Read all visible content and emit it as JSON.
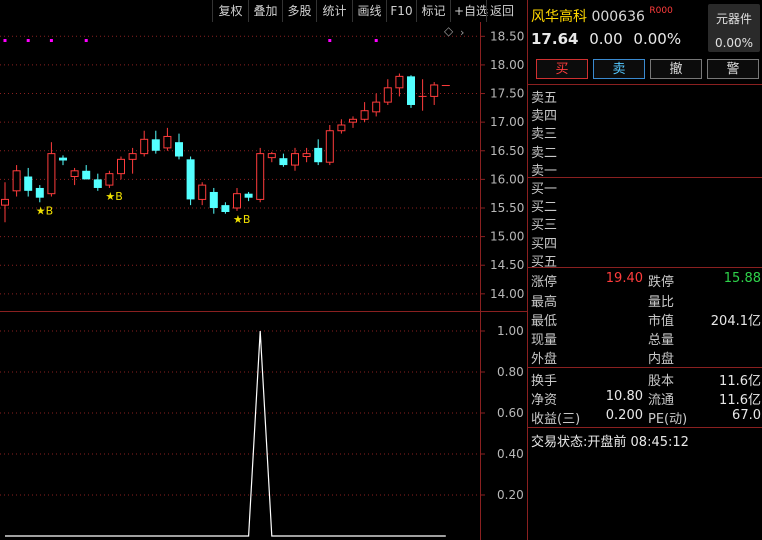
{
  "toolbar": {
    "items": [
      "复权",
      "叠加",
      "多股",
      "统计",
      "画线",
      "F10",
      "标记",
      "+自选",
      "返回"
    ]
  },
  "chart": {
    "price_ticks": [
      "18.50",
      "18.00",
      "17.50",
      "17.00",
      "16.50",
      "16.00",
      "15.50",
      "15.00",
      "14.50",
      "14.00"
    ],
    "indicator_ticks": [
      "1.00",
      "0.80",
      "0.60",
      "0.40",
      "0.20"
    ],
    "signal_label": "★B",
    "colors": {
      "up": "#ff3c3c",
      "down": "#54ffff",
      "signal": "#f0e000",
      "marker": "#ff00ff",
      "grid": "#8a2020"
    }
  },
  "chart_data": {
    "type": "candlestick",
    "price_axis": [
      13.7,
      18.75
    ],
    "indicator_axis": [
      0,
      1.0
    ],
    "candles": [
      {
        "o": 15.55,
        "h": 15.95,
        "l": 15.25,
        "c": 15.65
      },
      {
        "o": 15.8,
        "h": 16.25,
        "l": 15.7,
        "c": 16.15
      },
      {
        "o": 16.05,
        "h": 16.2,
        "l": 15.7,
        "c": 15.8
      },
      {
        "o": 15.85,
        "h": 15.9,
        "l": 15.6,
        "c": 15.68
      },
      {
        "o": 15.75,
        "h": 16.65,
        "l": 15.7,
        "c": 16.45
      },
      {
        "o": 16.38,
        "h": 16.42,
        "l": 16.25,
        "c": 16.33
      },
      {
        "o": 16.05,
        "h": 16.2,
        "l": 15.9,
        "c": 16.15
      },
      {
        "o": 16.15,
        "h": 16.25,
        "l": 16.0,
        "c": 16.0
      },
      {
        "o": 16.0,
        "h": 16.1,
        "l": 15.8,
        "c": 15.85
      },
      {
        "o": 15.9,
        "h": 16.15,
        "l": 15.85,
        "c": 16.1
      },
      {
        "o": 16.1,
        "h": 16.4,
        "l": 16.0,
        "c": 16.35
      },
      {
        "o": 16.35,
        "h": 16.55,
        "l": 16.1,
        "c": 16.45
      },
      {
        "o": 16.45,
        "h": 16.85,
        "l": 16.4,
        "c": 16.7
      },
      {
        "o": 16.7,
        "h": 16.85,
        "l": 16.45,
        "c": 16.5
      },
      {
        "o": 16.55,
        "h": 16.9,
        "l": 16.5,
        "c": 16.75
      },
      {
        "o": 16.65,
        "h": 16.8,
        "l": 16.35,
        "c": 16.4
      },
      {
        "o": 16.35,
        "h": 16.4,
        "l": 15.55,
        "c": 15.65
      },
      {
        "o": 15.65,
        "h": 15.95,
        "l": 15.55,
        "c": 15.9
      },
      {
        "o": 15.78,
        "h": 15.85,
        "l": 15.4,
        "c": 15.5
      },
      {
        "o": 15.55,
        "h": 15.6,
        "l": 15.4,
        "c": 15.43
      },
      {
        "o": 15.5,
        "h": 15.85,
        "l": 15.45,
        "c": 15.75
      },
      {
        "o": 15.75,
        "h": 15.78,
        "l": 15.62,
        "c": 15.68
      },
      {
        "o": 15.65,
        "h": 16.55,
        "l": 15.6,
        "c": 16.45
      },
      {
        "o": 16.38,
        "h": 16.48,
        "l": 16.3,
        "c": 16.45
      },
      {
        "o": 16.37,
        "h": 16.45,
        "l": 16.22,
        "c": 16.25
      },
      {
        "o": 16.25,
        "h": 16.55,
        "l": 16.15,
        "c": 16.45
      },
      {
        "o": 16.4,
        "h": 16.55,
        "l": 16.3,
        "c": 16.45
      },
      {
        "o": 16.55,
        "h": 16.7,
        "l": 16.25,
        "c": 16.3
      },
      {
        "o": 16.3,
        "h": 16.95,
        "l": 16.25,
        "c": 16.85
      },
      {
        "o": 16.85,
        "h": 17.05,
        "l": 16.8,
        "c": 16.95
      },
      {
        "o": 17.0,
        "h": 17.1,
        "l": 16.9,
        "c": 17.05
      },
      {
        "o": 17.05,
        "h": 17.35,
        "l": 17.0,
        "c": 17.2
      },
      {
        "o": 17.18,
        "h": 17.5,
        "l": 17.1,
        "c": 17.35
      },
      {
        "o": 17.35,
        "h": 17.75,
        "l": 17.3,
        "c": 17.6
      },
      {
        "o": 17.6,
        "h": 17.85,
        "l": 17.45,
        "c": 17.8
      },
      {
        "o": 17.8,
        "h": 17.82,
        "l": 17.25,
        "c": 17.3
      },
      {
        "o": 17.45,
        "h": 17.75,
        "l": 17.2,
        "c": 17.45
      },
      {
        "o": 17.45,
        "h": 17.7,
        "l": 17.3,
        "c": 17.65
      },
      {
        "o": 17.64,
        "h": 17.64,
        "l": 17.64,
        "c": 17.64
      }
    ],
    "signals_at_index": [
      3,
      9,
      20
    ],
    "top_markers_at_index": [
      0,
      2,
      4,
      7,
      28,
      32
    ],
    "indicator_values": [
      0,
      0,
      0,
      0,
      0,
      0,
      0,
      0,
      0,
      0,
      0,
      0,
      0,
      0,
      0,
      0,
      0,
      0,
      0,
      0,
      0,
      0,
      1.0,
      0,
      0,
      0,
      0,
      0,
      0,
      0,
      0,
      0,
      0,
      0,
      0,
      0,
      0,
      0,
      0
    ]
  },
  "stock": {
    "name": "风华高科",
    "code": "000636",
    "badge": "R000",
    "price": "17.64",
    "change": "0.00",
    "change_pct": "0.00%",
    "sector_name": "元器件",
    "sector_pct": "0.00%"
  },
  "buttons": {
    "buy": "买",
    "sell": "卖",
    "cancel": "撤",
    "alert": "警"
  },
  "order_book": {
    "asks": [
      "卖五",
      "卖四",
      "卖三",
      "卖二",
      "卖一"
    ],
    "bids": [
      "买一",
      "买二",
      "买三",
      "买四",
      "买五"
    ]
  },
  "quote": {
    "limit_up_label": "涨停",
    "limit_up": "19.40",
    "limit_down_label": "跌停",
    "limit_down": "15.88",
    "high_label": "最高",
    "vol_ratio_label": "量比",
    "low_label": "最低",
    "mkt_cap_label": "市值",
    "mkt_cap": "204.1亿",
    "now_label": "现量",
    "total_vol_label": "总量",
    "outer_label": "外盘",
    "inner_label": "内盘",
    "turnover_label": "换手",
    "share_cap_label": "股本",
    "share_cap": "11.6亿",
    "nav_label": "净资",
    "nav": "10.80",
    "float_label": "流通",
    "float": "11.6亿",
    "eps_label": "收益(三)",
    "eps": "0.200",
    "pe_label": "PE(动)",
    "pe": "67.0"
  },
  "status": {
    "label": "交易状态:",
    "value": "开盘前 08:45:12"
  }
}
